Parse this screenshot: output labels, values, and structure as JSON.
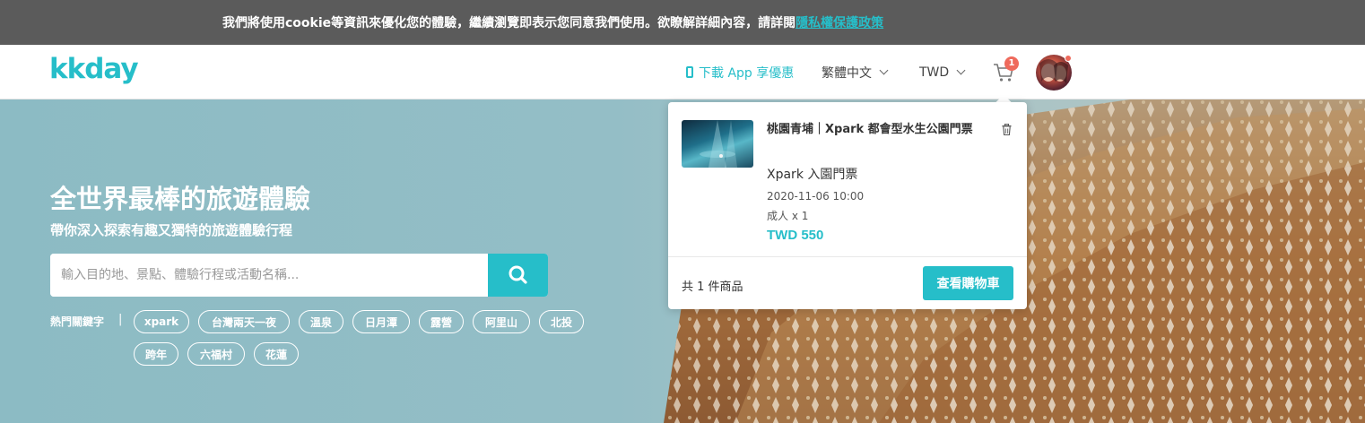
{
  "cookie_banner": {
    "text": "我們將使用cookie等資訊來優化您的體驗，繼續瀏覽即表示您同意我們使用。欲瞭解詳細內容，請詳閱",
    "link": "隱私權保護政策"
  },
  "header": {
    "logo": "kkday",
    "app_download": "下載 App 享優惠",
    "language": "繁體中文",
    "currency": "TWD",
    "cart_count": "1"
  },
  "hero": {
    "title": "全世界最棒的旅遊體驗",
    "subtitle": "帶你深入探索有趣又獨特的旅遊體驗行程",
    "search_placeholder": "輸入目的地、景點、體驗行程或活動名稱...",
    "keywords_label": "熱門關鍵字",
    "keywords_separator": "|",
    "keywords": [
      "xpark",
      "台灣兩天一夜",
      "溫泉",
      "日月潭",
      "露營",
      "阿里山",
      "北投",
      "跨年",
      "六福村",
      "花蓮"
    ]
  },
  "cart_popup": {
    "product_title": "桃園青埔｜Xpark 都會型水生公園門票",
    "option": "Xpark 入園門票",
    "date": "2020-11-06 10:00",
    "quantity": "成人 x 1",
    "price": "TWD 550",
    "item_count": "共 1 件商品",
    "view_cart_button": "查看購物車"
  },
  "colors": {
    "brand": "#26bec9",
    "badge": "#ef6a5c",
    "banner_bg": "#5b5b5b"
  }
}
